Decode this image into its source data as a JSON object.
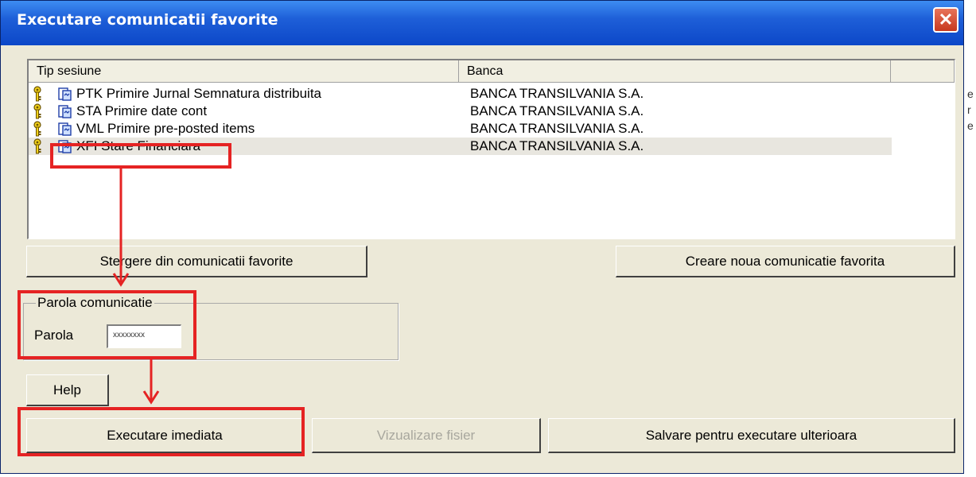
{
  "window": {
    "title": "Executare comunicatii favorite",
    "close_glyph": "✕"
  },
  "list": {
    "columns": [
      "Tip sesiune",
      "Banca"
    ],
    "rows": [
      {
        "label": "PTK Primire Jurnal Semnatura distribuita",
        "bank": "BANCA TRANSILVANIA S.A."
      },
      {
        "label": "STA Primire date cont",
        "bank": "BANCA TRANSILVANIA S.A."
      },
      {
        "label": "VML Primire pre-posted items",
        "bank": "BANCA TRANSILVANIA S.A."
      },
      {
        "label": "XFI Stare Financiara",
        "bank": "BANCA TRANSILVANIA S.A.",
        "selected": true
      }
    ],
    "row_icons": [
      "key-icon",
      "document-icon"
    ]
  },
  "buttons": {
    "delete_favorite": "Stergere din comunicatii favorite",
    "create_favorite": "Creare noua comunicatie favorita",
    "help": "Help",
    "execute_now": "Executare imediata",
    "view_file": "Vizualizare fisier",
    "save_for_later": "Salvare pentru executare ulterioara"
  },
  "password": {
    "group_label": "Parola comunicatie",
    "field_label": "Parola",
    "value": "xxxxxxxx"
  },
  "edge_glyphs": [
    "e",
    "r",
    "e"
  ],
  "colors": {
    "title_bar": "#0c47c8",
    "highlight": "#e52323",
    "window_bg": "#ece9d8",
    "selected_row": "#e8e6df"
  }
}
